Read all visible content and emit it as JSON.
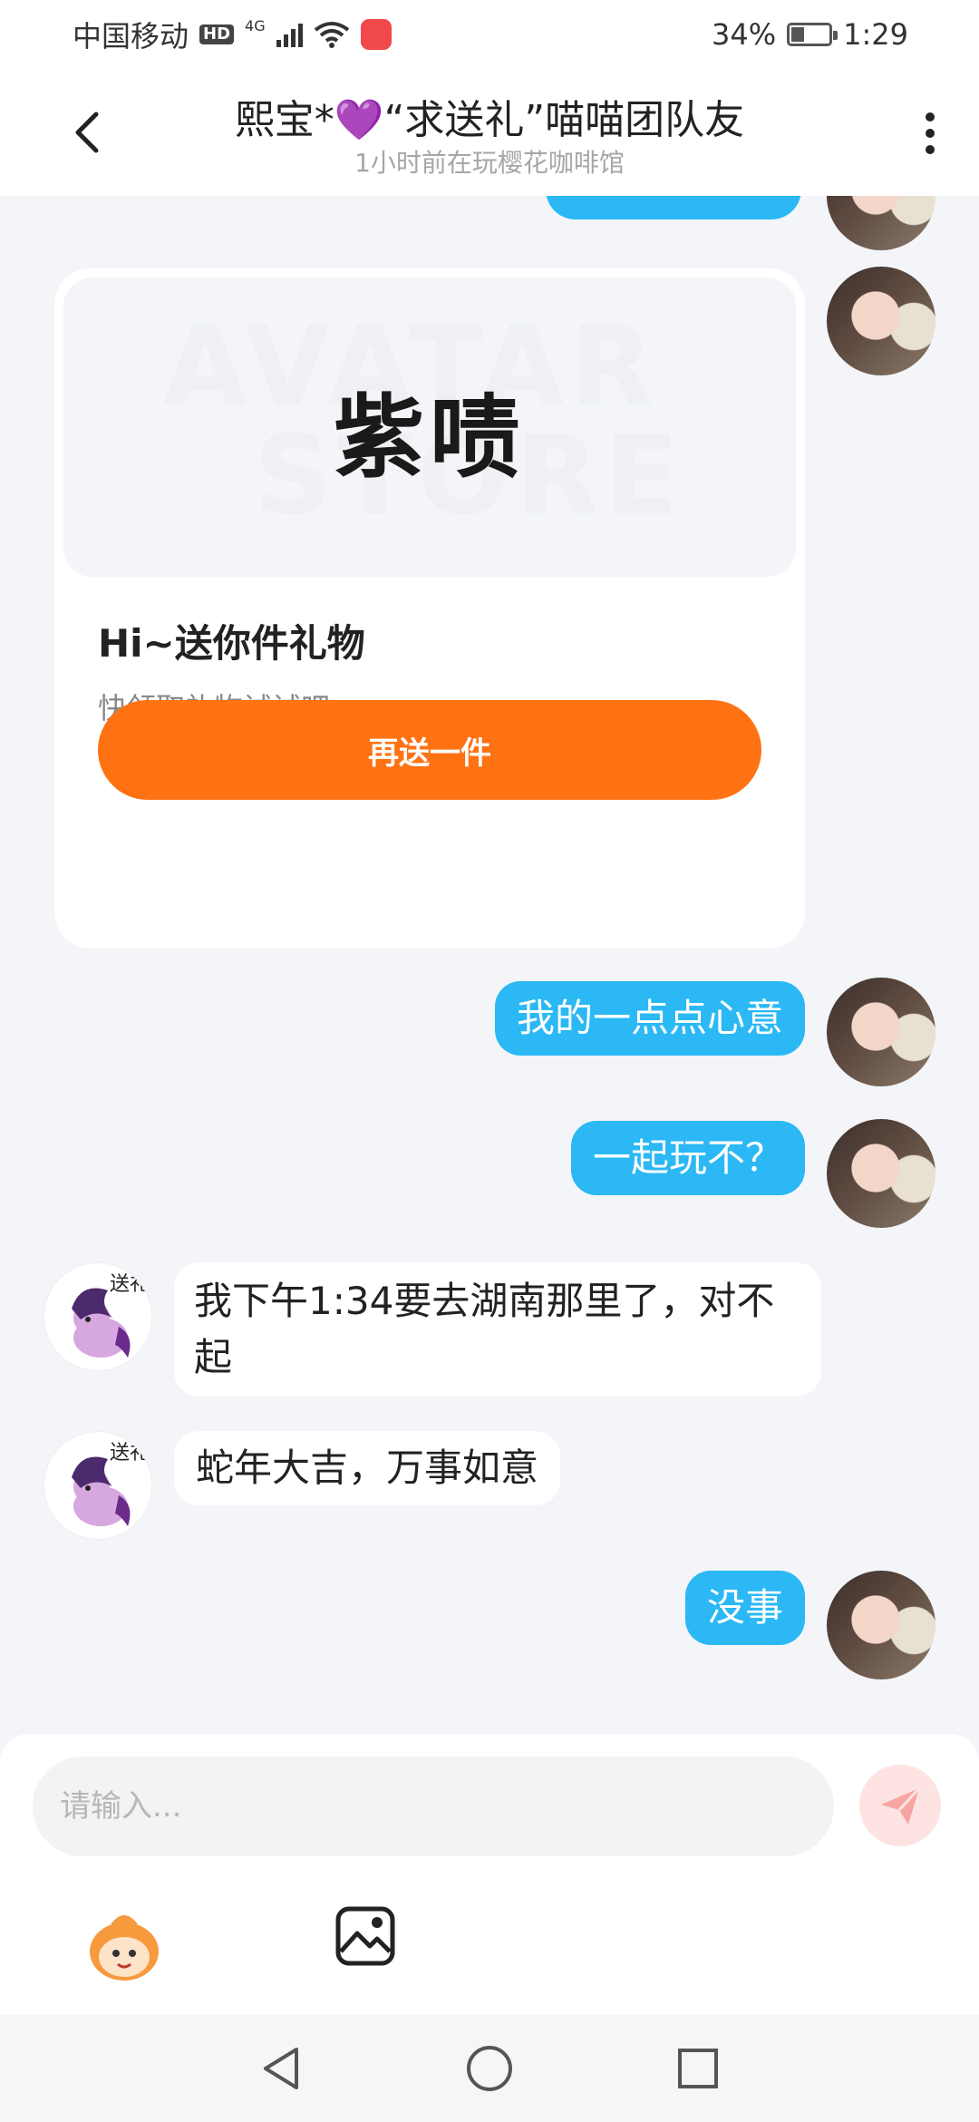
{
  "status_bar": {
    "carrier": "中国移动",
    "hd": "HD",
    "network": "4G",
    "battery": "34%",
    "time": "1:29"
  },
  "header": {
    "title": "熙宝*💜“求送礼”喵喵团队友",
    "subtitle": "1小时前在玩樱花咖啡馆"
  },
  "gift_card": {
    "watermark_line1": "AVATAR",
    "watermark_line2": "STORE",
    "gift_text": "紫啧",
    "title": "Hi~送你件礼物",
    "subtitle": "快领取礼物试试吧~",
    "button_label": "再送一件"
  },
  "messages": [
    {
      "sender": "me",
      "text": "我的一点点心意"
    },
    {
      "sender": "me",
      "text": "一起玩不？"
    },
    {
      "sender": "friend",
      "text": "我下午1:34要去湖南那里了，对不起"
    },
    {
      "sender": "friend",
      "text": "蛇年大吉，万事如意"
    },
    {
      "sender": "me",
      "text": "没事"
    }
  ],
  "friend_avatar_tag": "送礼",
  "input": {
    "placeholder": "请输入..."
  },
  "icons": {
    "back": "back-arrow-icon",
    "more": "more-vertical-icon",
    "send": "send-icon",
    "emoji": "emoji-sticker-icon",
    "image": "image-icon",
    "nav_back": "nav-back-icon",
    "nav_home": "nav-home-icon",
    "nav_recent": "nav-recent-icon"
  },
  "colors": {
    "accent_blue": "#2bb8f5",
    "accent_orange": "#fe7213",
    "background": "#f3f5f8",
    "send_pink": "#fde3e2"
  }
}
